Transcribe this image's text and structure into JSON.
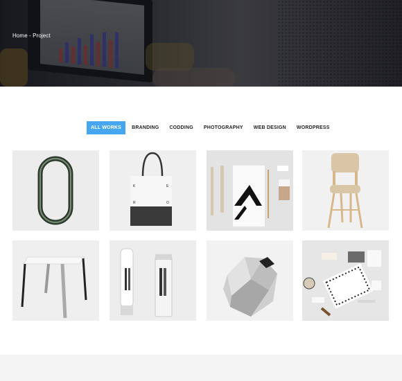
{
  "hero": {
    "breadcrumb": "Home - Project"
  },
  "filters": [
    {
      "label": "ALL WORKS",
      "active": true
    },
    {
      "label": "BRANDING",
      "active": false
    },
    {
      "label": "CODDING",
      "active": false
    },
    {
      "label": "PHOTOGRAPHY",
      "active": false
    },
    {
      "label": "WEB DESIGN",
      "active": false
    },
    {
      "label": "WORDPRESS",
      "active": false
    }
  ],
  "colors": {
    "accent": "#46a6ef"
  },
  "portfolio": [
    {
      "icon": "ring-object-image"
    },
    {
      "icon": "tote-bag-image",
      "text": "K E R O"
    },
    {
      "icon": "cutlery-stationery-image"
    },
    {
      "icon": "wooden-chair-image"
    },
    {
      "icon": "stool-image"
    },
    {
      "icon": "cosmetic-tubes-image"
    },
    {
      "icon": "geometric-speaker-image"
    },
    {
      "icon": "stationery-set-image"
    }
  ]
}
